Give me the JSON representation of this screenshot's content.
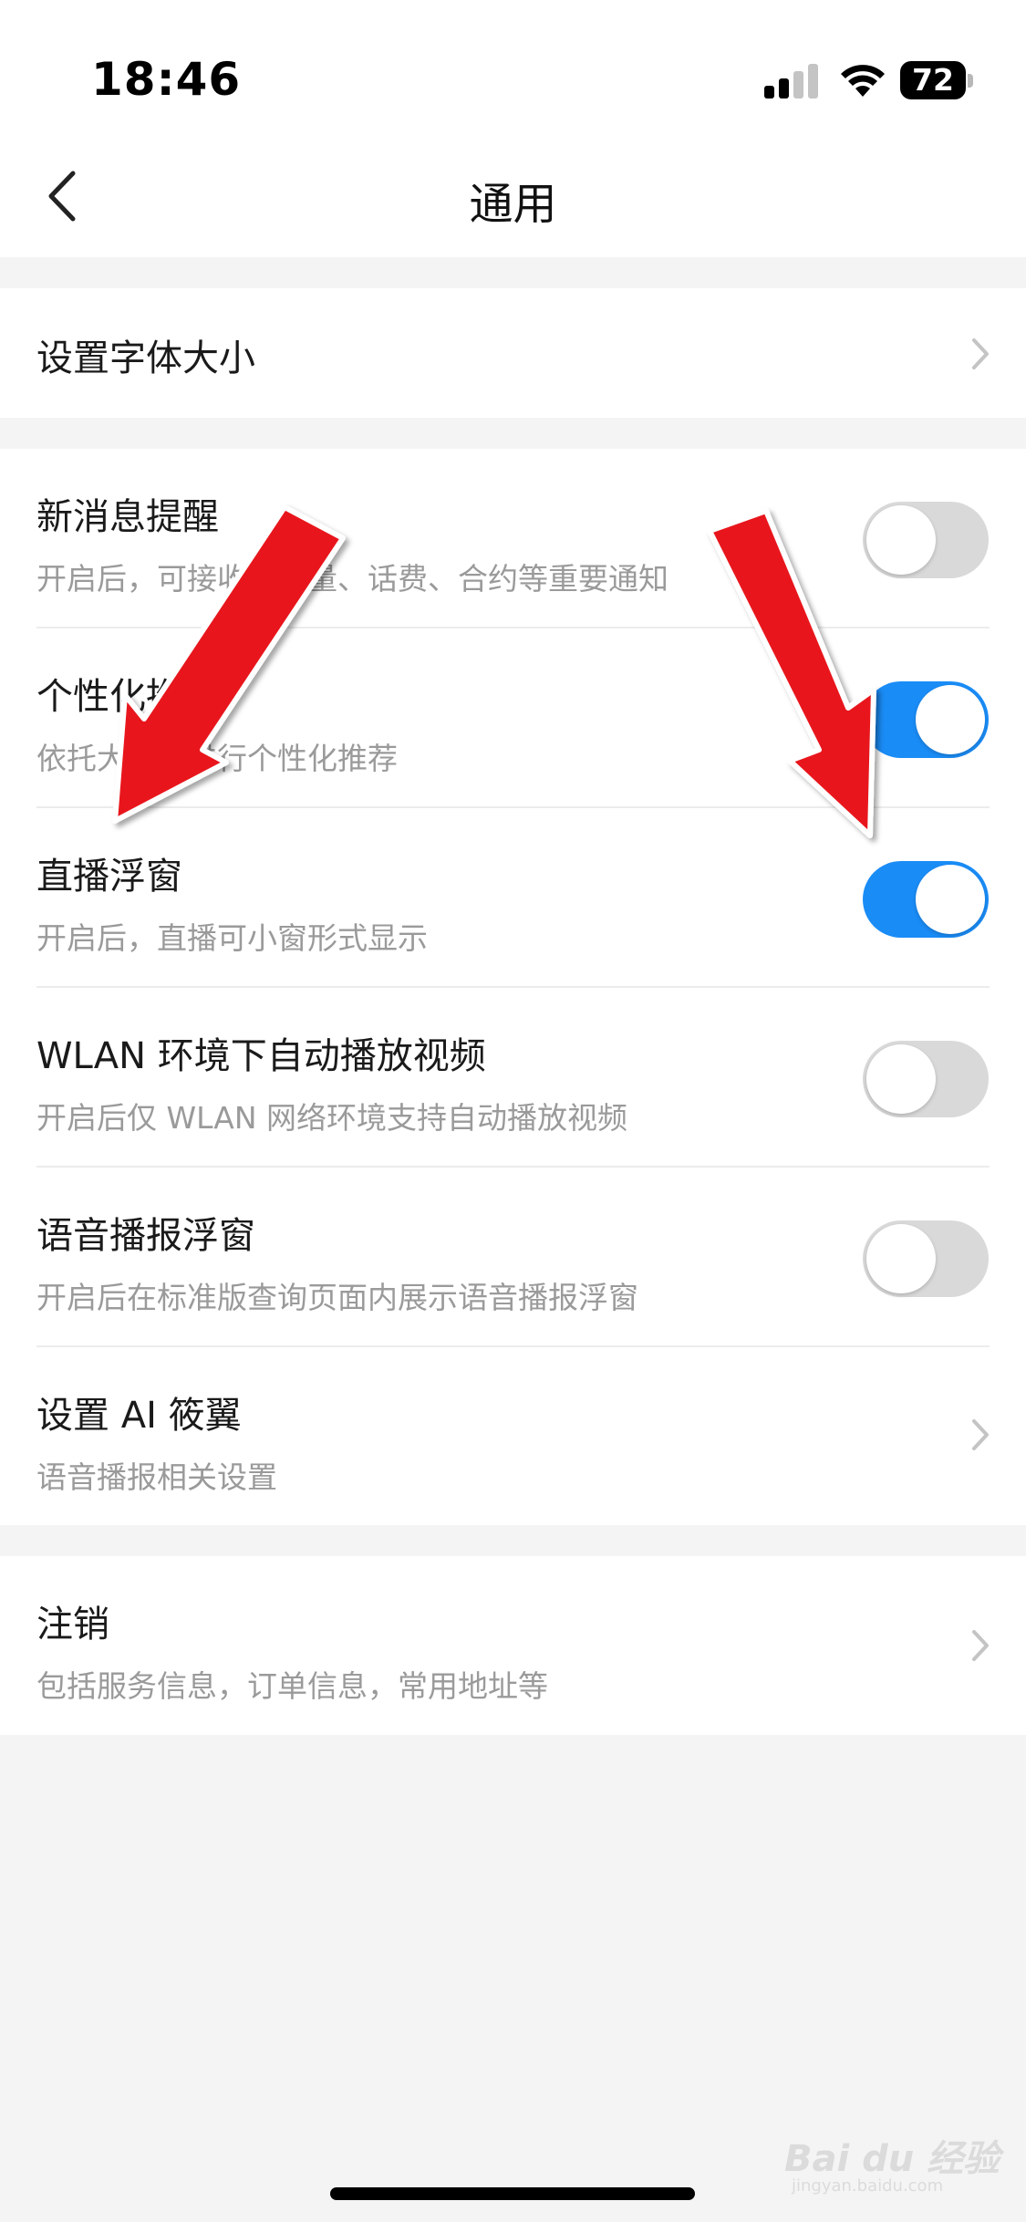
{
  "status_bar": {
    "time": "18:46",
    "battery": "72"
  },
  "nav": {
    "title": "通用",
    "back_icon": "chevron-left-icon"
  },
  "groups": [
    {
      "rows": [
        {
          "title": "设置字体大小",
          "control": "chevron"
        }
      ]
    },
    {
      "rows": [
        {
          "title": "新消息提醒",
          "subtitle": "开启后，可接收到流量、话费、合约等重要通知",
          "control": "toggle",
          "on": false
        },
        {
          "title": "个性化推荐",
          "subtitle": "依托大数据进行个性化推荐",
          "control": "toggle",
          "on": true
        },
        {
          "title": "直播浮窗",
          "subtitle": "开启后，直播可小窗形式显示",
          "control": "toggle",
          "on": true
        },
        {
          "title": "WLAN 环境下自动播放视频",
          "subtitle": "开启后仅 WLAN 网络环境支持自动播放视频",
          "control": "toggle",
          "on": false
        },
        {
          "title": "语音播报浮窗",
          "subtitle": "开启后在标准版查询页面内展示语音播报浮窗",
          "control": "toggle",
          "on": false
        },
        {
          "title": "设置 AI 筱翼",
          "subtitle": "语音播报相关设置",
          "control": "chevron"
        }
      ]
    },
    {
      "rows": [
        {
          "title": "注销",
          "subtitle": "包括服务信息，订单信息，常用地址等",
          "control": "chevron"
        }
      ]
    }
  ],
  "colors": {
    "toggle_on": "#1a8cf6",
    "toggle_off": "#d9d9d9",
    "annotation_arrow": "#e8141b"
  },
  "watermark": {
    "text": "Bai du 经验",
    "sub": "jingyan.baidu.com"
  }
}
